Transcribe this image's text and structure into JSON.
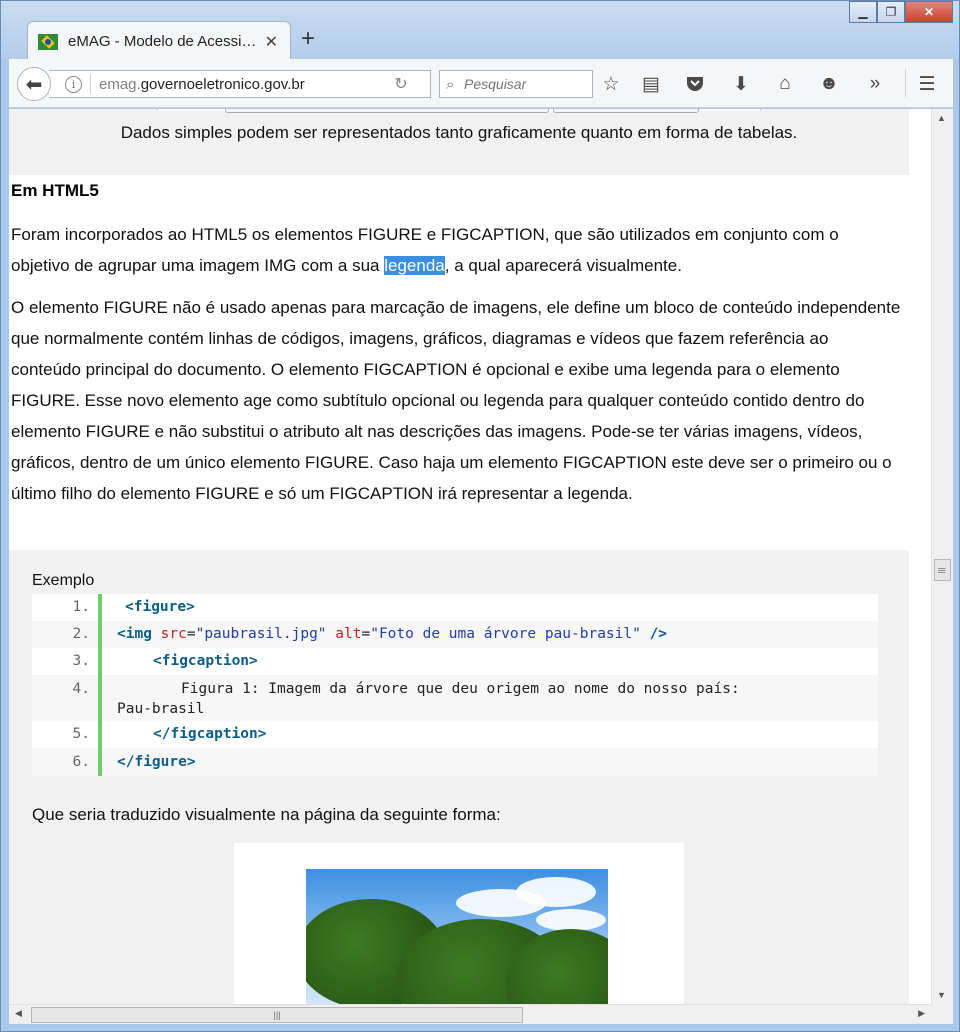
{
  "browser": {
    "tab_title": "eMAG - Modelo de Acessi…",
    "tab_close": "✕",
    "new_tab": "+",
    "url_prefix": "emag.",
    "url_domain": "governoeletronico.gov.br",
    "search_placeholder": "Pesquisar",
    "window_buttons": {
      "minimize": "▁",
      "maximize": "❐",
      "close": "✕"
    },
    "icons": [
      "back-icon",
      "info-icon",
      "reload-icon",
      "search-icon",
      "star-icon",
      "reading-list-icon",
      "pocket-icon",
      "download-icon",
      "home-icon",
      "smiley-icon",
      "overflow-icon",
      "menu-icon"
    ]
  },
  "page": {
    "top_caption": "Dados simples podem ser representados tanto graficamente quanto em forma de tabelas.",
    "heading": "Em HTML5",
    "para1_before": "Foram incorporados ao HTML5 os elementos FIGURE e FIGCAPTION, que são utilizados em conjunto com o objetivo de agrupar uma imagem IMG com a sua ",
    "para1_highlight": "legenda",
    "para1_after": ", a qual aparecerá visualmente.",
    "para2": "O elemento FIGURE não é usado apenas para marcação de imagens, ele define um bloco de conteúdo independente que normalmente contém linhas de códigos, imagens, gráficos, diagramas e vídeos que fazem referência ao conteúdo principal do documento. O elemento FIGCAPTION é opcional e exibe uma legenda para o elemento FIGURE. Esse novo elemento age como subtítulo opcional ou legenda para qualquer conteúdo contido dentro do elemento FIGURE e não substitui o atributo alt nas descrições das imagens. Pode-se ter várias imagens, vídeos, gráficos, dentro de um único elemento FIGURE. Caso haja um elemento FIGCAPTION este deve ser o primeiro ou o último filho do elemento FIGURE e só um FIGCAPTION irá representar a legenda.",
    "example_label": "Exemplo",
    "code_lines": [
      {
        "num": "1.",
        "tag_open": "<figure>"
      },
      {
        "num": "2.",
        "tag_open": "<img",
        "attr1": "src",
        "val1": "\"paubrasil.jpg\"",
        "attr2": "alt",
        "val2": "\"Foto de uma árvore pau-brasil\"",
        "tag_close": "/>"
      },
      {
        "num": "3.",
        "tag_open": "<figcaption>"
      },
      {
        "num": "4.",
        "text_line1": "Figura 1: Imagem da árvore que deu origem ao nome do nosso país:",
        "text_line2": "Pau-brasil"
      },
      {
        "num": "5.",
        "tag_open": "</figcaption>"
      },
      {
        "num": "6.",
        "tag_open": "</figure>"
      }
    ],
    "traduzido": "Que seria traduzido visualmente na página da seguinte forma:"
  },
  "scrollbars": {
    "up": "▲",
    "down": "▼",
    "left": "◀",
    "right": "▶",
    "grip": "|||"
  }
}
